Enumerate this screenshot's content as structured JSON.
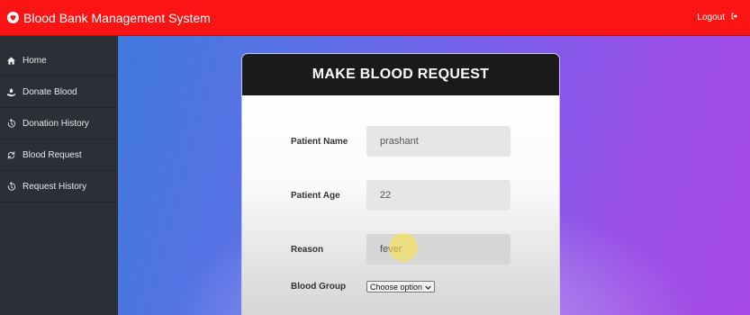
{
  "header": {
    "title": "Blood Bank Management System",
    "logout_label": "Logout"
  },
  "sidebar": {
    "items": [
      {
        "label": "Home",
        "icon": "home-icon"
      },
      {
        "label": "Donate Blood",
        "icon": "donate-icon"
      },
      {
        "label": "Donation History",
        "icon": "history-icon"
      },
      {
        "label": "Blood Request",
        "icon": "refresh-icon"
      },
      {
        "label": "Request History",
        "icon": "history-icon"
      }
    ]
  },
  "form": {
    "title": "MAKE BLOOD REQUEST",
    "patient_name_label": "Patient Name",
    "patient_name_value": "prashant",
    "patient_age_label": "Patient Age",
    "patient_age_value": "22",
    "reason_label": "Reason",
    "reason_value": "fever",
    "blood_group_label": "Blood Group",
    "blood_group_selected": "Choose option"
  },
  "colors": {
    "topbar": "#fb1414",
    "sidebar": "#2c2f35",
    "card_header": "#1a1a1a"
  }
}
